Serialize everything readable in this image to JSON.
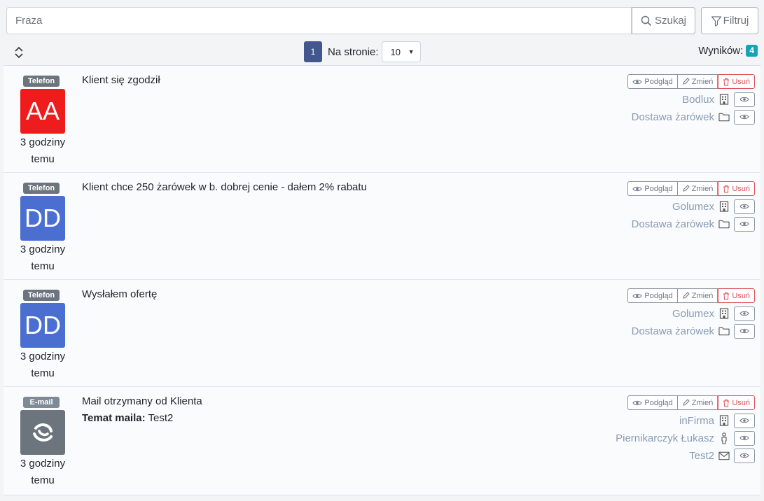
{
  "search": {
    "placeholder": "Fraza",
    "search_label": "Szukaj",
    "filter_label": "Filtruj"
  },
  "toolbar": {
    "page": "1",
    "per_page_label": "Na stronie:",
    "per_page_value": "10",
    "results_label": "Wyników:",
    "results_count": "4"
  },
  "actions": {
    "preview": "Podgląd",
    "edit": "Zmień",
    "delete": "Usuń"
  },
  "items": [
    {
      "type": "Telefon",
      "avatar": "AA",
      "avatar_color": "#ee1c1c",
      "time_line1": "3 godziny",
      "time_line2": "temu",
      "title": "Klient się zgodził",
      "links": [
        {
          "text": "Bodlux",
          "icon": "building-icon"
        },
        {
          "text": "Dostawa żarówek",
          "icon": "folder-icon"
        }
      ]
    },
    {
      "type": "Telefon",
      "avatar": "DD",
      "avatar_color": "#4a6fd0",
      "time_line1": "3 godziny",
      "time_line2": "temu",
      "title": "Klient chce 250 żarówek w b. dobrej cenie - dałem 2% rabatu",
      "links": [
        {
          "text": "Golumex",
          "icon": "building-icon"
        },
        {
          "text": "Dostawa żarówek",
          "icon": "folder-icon"
        }
      ]
    },
    {
      "type": "Telefon",
      "avatar": "DD",
      "avatar_color": "#4a6fd0",
      "time_line1": "3 godziny",
      "time_line2": "temu",
      "title": "Wysłałem ofertę",
      "links": [
        {
          "text": "Golumex",
          "icon": "building-icon"
        },
        {
          "text": "Dostawa żarówek",
          "icon": "folder-icon"
        }
      ]
    },
    {
      "type": "E-mail",
      "avatar_icon": "mail-logo-icon",
      "avatar_color": "#6c757d",
      "time_line1": "3 godziny",
      "time_line2": "temu",
      "title": "Mail otrzymany od Klienta",
      "sub_label": "Temat maila:",
      "sub_value": " Test2",
      "links": [
        {
          "text": "inFirma",
          "icon": "building-icon"
        },
        {
          "text": "Piernikarczyk Łukasz",
          "icon": "person-icon"
        },
        {
          "text": "Test2",
          "icon": "envelope-icon"
        }
      ]
    }
  ]
}
